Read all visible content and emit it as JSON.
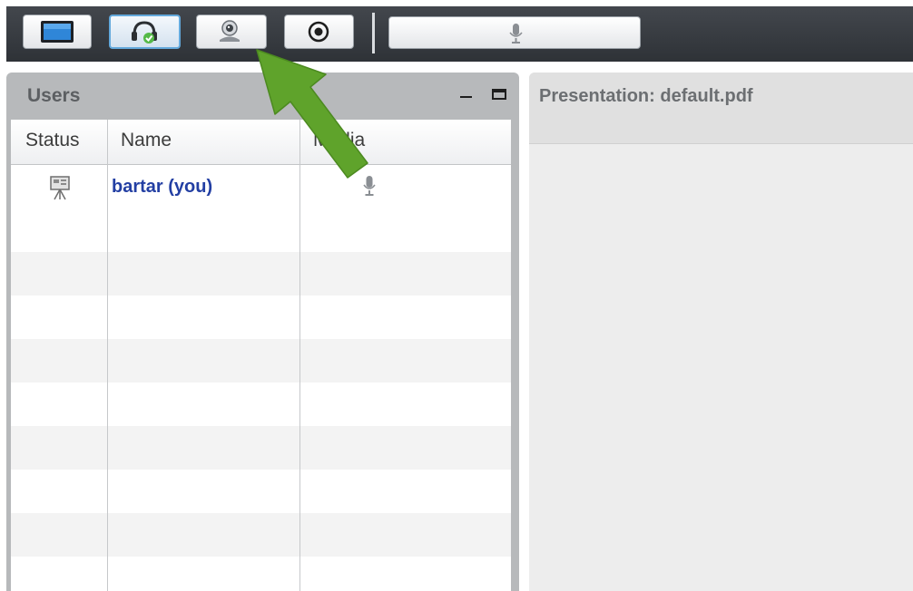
{
  "toolbar": {
    "buttons": [
      {
        "name": "desktop-share",
        "icon": "monitor-icon",
        "active": false
      },
      {
        "name": "audio-headset",
        "icon": "headset-icon",
        "active": true
      },
      {
        "name": "webcam",
        "icon": "webcam-icon",
        "active": false
      },
      {
        "name": "record",
        "icon": "record-icon",
        "active": false
      }
    ],
    "mic_icon": "microphone-icon"
  },
  "users_panel": {
    "title": "Users",
    "columns": [
      "Status",
      "Name",
      "Media"
    ],
    "rows": [
      {
        "status_icon": "presenter-icon",
        "name": "bartar (you)",
        "media_icon": "microphone-icon"
      }
    ]
  },
  "presentation_panel": {
    "title": "Presentation: default.pdf"
  },
  "colors": {
    "toolbar_bg": "#3a3e43",
    "active_border": "#63a9dc",
    "user_name": "#233fa3",
    "annotation_arrow": "#5fa32b"
  }
}
